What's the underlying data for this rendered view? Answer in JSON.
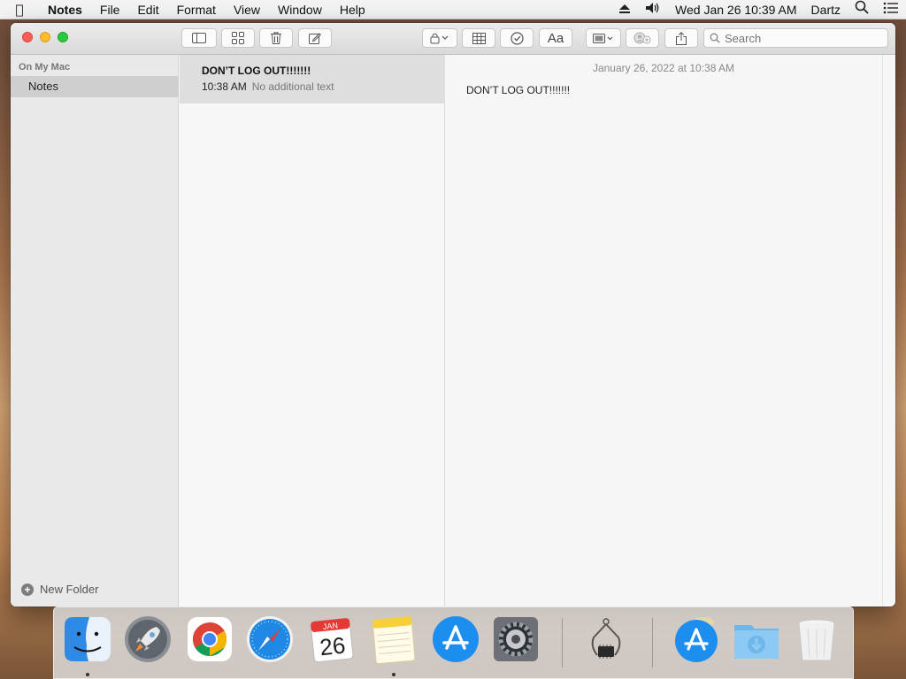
{
  "menubar": {
    "apple_icon": "apple-icon",
    "app_name": "Notes",
    "items": [
      "File",
      "Edit",
      "Format",
      "View",
      "Window",
      "Help"
    ],
    "datetime": "Wed Jan 26  10:39 AM",
    "user": "Dartz",
    "status_icons": [
      "eject-icon",
      "volume-icon",
      "spotlight-search-icon",
      "control-center-icon"
    ]
  },
  "toolbar": {
    "buttons": [
      "sidebar-toggle-icon",
      "gallery-view-icon",
      "trash-icon",
      "compose-icon",
      "lock-icon",
      "table-icon",
      "checklist-icon",
      "text-format-icon",
      "media-icon",
      "collaborate-icon",
      "share-icon"
    ],
    "format_label": "Aa",
    "search_placeholder": "Search"
  },
  "sidebar": {
    "section_label": "On My Mac",
    "folders": [
      "Notes"
    ],
    "new_folder_label": "New Folder"
  },
  "note_list": {
    "notes": [
      {
        "title": "DON’T LOG OUT!!!!!!!",
        "time": "10:38 AM",
        "preview": "No additional text"
      }
    ]
  },
  "editor": {
    "date": "January 26, 2022 at 10:38 AM",
    "body": "DON’T LOG OUT!!!!!!!"
  },
  "dock": {
    "apps": [
      "Finder",
      "Launchpad",
      "Google Chrome",
      "Safari",
      "Calendar",
      "Notes",
      "App Store",
      "System Preferences",
      "System Information",
      "App Store Installer",
      "Downloads",
      "Trash"
    ],
    "calendar_month": "JAN",
    "calendar_day": "26"
  },
  "colors": {
    "close": "#fc5f57",
    "minimize": "#fdbc2e",
    "zoom": "#29c840",
    "selection": "#dedede",
    "notes_yellow": "#f5d03b"
  }
}
